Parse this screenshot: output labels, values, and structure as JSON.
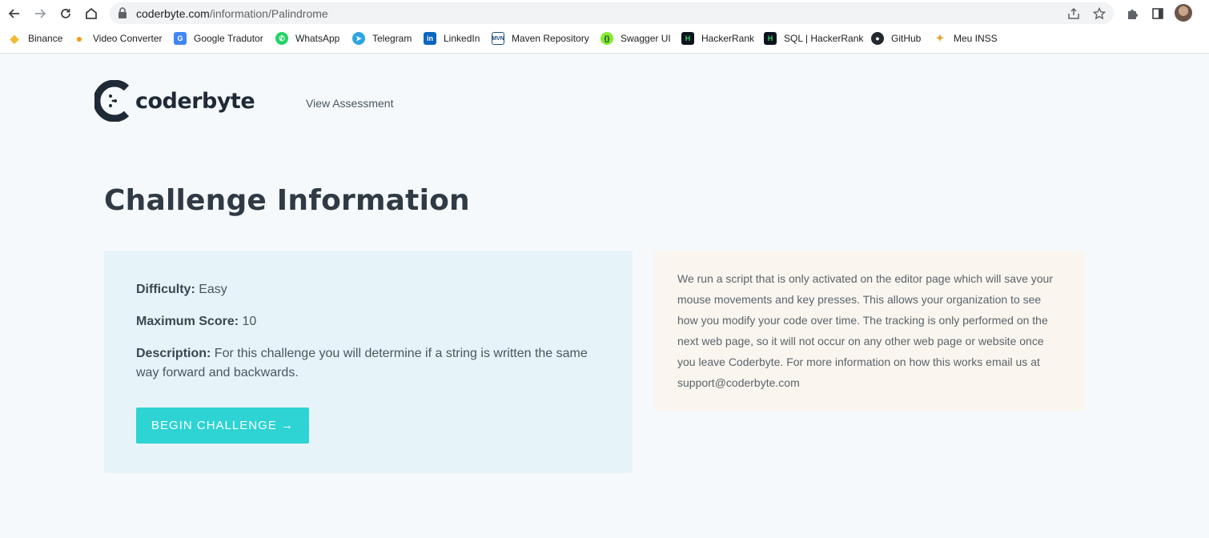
{
  "browser": {
    "url_host": "coderbyte.com",
    "url_path": "/information/Palindrome",
    "bookmarks": [
      {
        "label": "Binance",
        "icon": "binance-icon",
        "color": "#f3ba2f"
      },
      {
        "label": "Video Converter",
        "icon": "video-converter-icon",
        "color": "#f39c12"
      },
      {
        "label": "Google Tradutor",
        "icon": "google-translate-icon",
        "color": "#4285f4"
      },
      {
        "label": "WhatsApp",
        "icon": "whatsapp-icon",
        "color": "#25d366"
      },
      {
        "label": "Telegram",
        "icon": "telegram-icon",
        "color": "#2ca5e0"
      },
      {
        "label": "LinkedIn",
        "icon": "linkedin-icon",
        "color": "#0a66c2"
      },
      {
        "label": "Maven Repository",
        "icon": "maven-icon",
        "color": "#1f4e79"
      },
      {
        "label": "Swagger UI",
        "icon": "swagger-icon",
        "color": "#85ea2d"
      },
      {
        "label": "HackerRank",
        "icon": "hackerrank-icon",
        "color": "#0e141e"
      },
      {
        "label": "SQL | HackerRank",
        "icon": "hackerrank-icon",
        "color": "#0e141e"
      },
      {
        "label": "GitHub",
        "icon": "github-icon",
        "color": "#24292f"
      },
      {
        "label": "Meu INSS",
        "icon": "inss-icon",
        "color": "#e0a83b"
      }
    ]
  },
  "header": {
    "logo_text": "coderbyte",
    "nav_link": "View Assessment"
  },
  "main": {
    "title": "Challenge Information",
    "difficulty_label": "Difficulty:",
    "difficulty_value": "Easy",
    "max_score_label": "Maximum Score:",
    "max_score_value": "10",
    "description_label": "Description:",
    "description_value": "For this challenge you will determine if a string is written the same way forward and backwards.",
    "begin_button": "BEGIN CHALLENGE →",
    "notice": "We run a script that is only activated on the editor page which will save your mouse movements and key presses. This allows your organization to see how you modify your code over time. The tracking is only performed on the next web page, so it will not occur on any other web page or website once you leave Coderbyte. For more information on how this works email us at support@coderbyte.com"
  },
  "colors": {
    "accent": "#2ed3d3",
    "card_left_bg": "#e6f4f9",
    "card_right_bg": "#faf6ef",
    "page_bg": "#f5f9fb"
  }
}
